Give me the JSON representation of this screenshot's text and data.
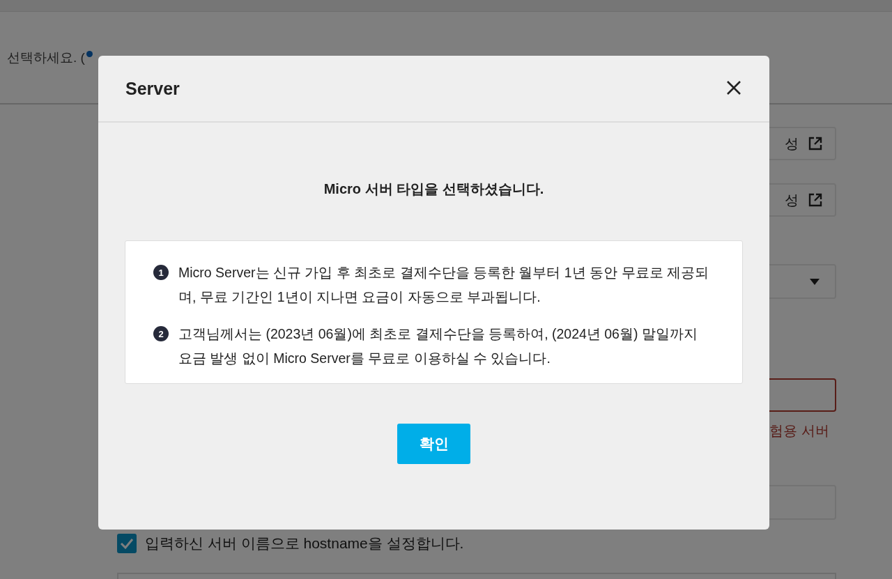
{
  "background": {
    "header_text": "선택하세요. (",
    "link_buttons": [
      {
        "label": "성"
      },
      {
        "label": "성"
      }
    ],
    "error_text": "험용 서버",
    "hostname_checkbox": {
      "label": "입력하신 서버 이름으로 hostname을 설정합니다.",
      "checked": true
    }
  },
  "dialog": {
    "title": "Server",
    "heading": "Micro 서버 타입을 선택하셨습니다.",
    "notes": [
      {
        "number": "1",
        "text": "Micro Server는 신규 가입 후 최초로 결제수단을 등록한 월부터 1년 동안 무료로 제공되며, 무료 기간인 1년이 지나면 요금이 자동으로 부과됩니다."
      },
      {
        "number": "2",
        "text": "고객님께서는 (2023년 06월)에 최초로 결제수단을 등록하여, (2024년 06월) 말일까지 요금 발생 없이 Micro Server를 무료로 이용하실 수 있습니다."
      }
    ],
    "confirm_button": "확인"
  }
}
